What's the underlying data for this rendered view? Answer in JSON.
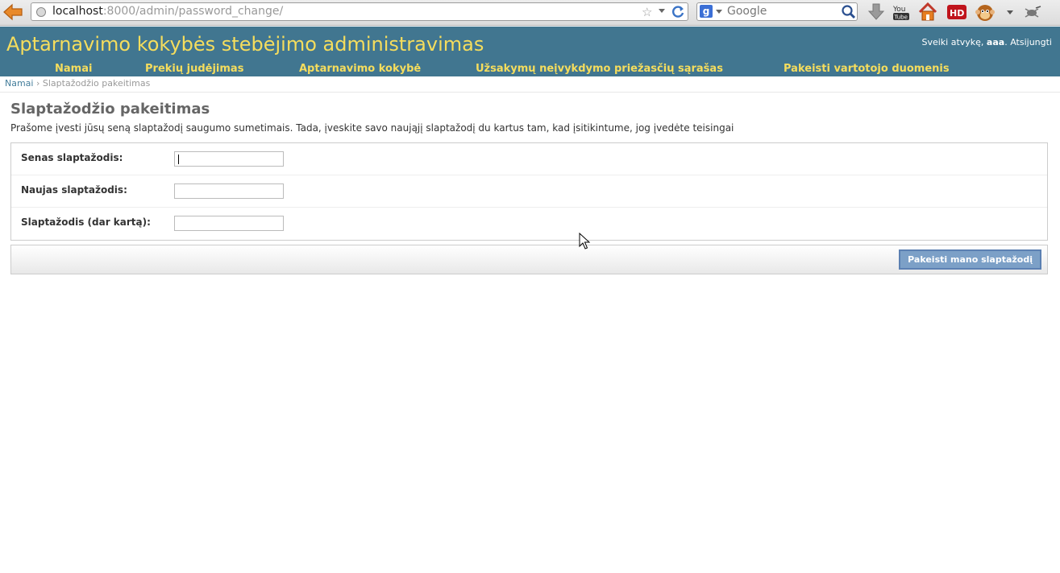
{
  "browser": {
    "url_host": "localhost",
    "url_path": ":8000/admin/password_change/",
    "search_engine": "Google",
    "search_placeholder": "Google",
    "toolbar_icons": [
      "download-icon",
      "youtube-icon",
      "home-icon",
      "hd-icon",
      "monkey-addon-icon",
      "bug-icon"
    ]
  },
  "header": {
    "site_name": "Aptarnavimo kokybės stebėjimo administravimas",
    "welcome": "Sveiki atvykę,",
    "username": "aaa",
    "logout": "Atsijungti"
  },
  "nav": [
    {
      "label": "Namai"
    },
    {
      "label": "Prekių judėjimas"
    },
    {
      "label": "Aptarnavimo kokybė"
    },
    {
      "label": "Užsakymų neįvykdymo priežasčių sąrašas"
    },
    {
      "label": "Pakeisti vartotojo duomenis"
    }
  ],
  "breadcrumbs": {
    "home": "Namai",
    "separator": "›",
    "current": "Slaptažodžio pakeitimas"
  },
  "content": {
    "title": "Slaptažodžio pakeitimas",
    "intro": "Prašome įvesti jūsų seną slaptažodį saugumo sumetimais. Tada, įveskite savo naująjį slaptažodį du kartus tam, kad įsitikintume, jog įvedėte teisingai",
    "fields": [
      {
        "label": "Senas slaptažodis:",
        "value": ""
      },
      {
        "label": "Naujas slaptažodis:",
        "value": ""
      },
      {
        "label": "Slaptažodis (dar kartą):",
        "value": ""
      }
    ],
    "submit_label": "Pakeisti mano slaptažodį"
  },
  "colors": {
    "header_bg": "#417690",
    "header_text": "#f5dd5d",
    "link": "#447e9b",
    "button_bg": "#7ca0c7"
  }
}
